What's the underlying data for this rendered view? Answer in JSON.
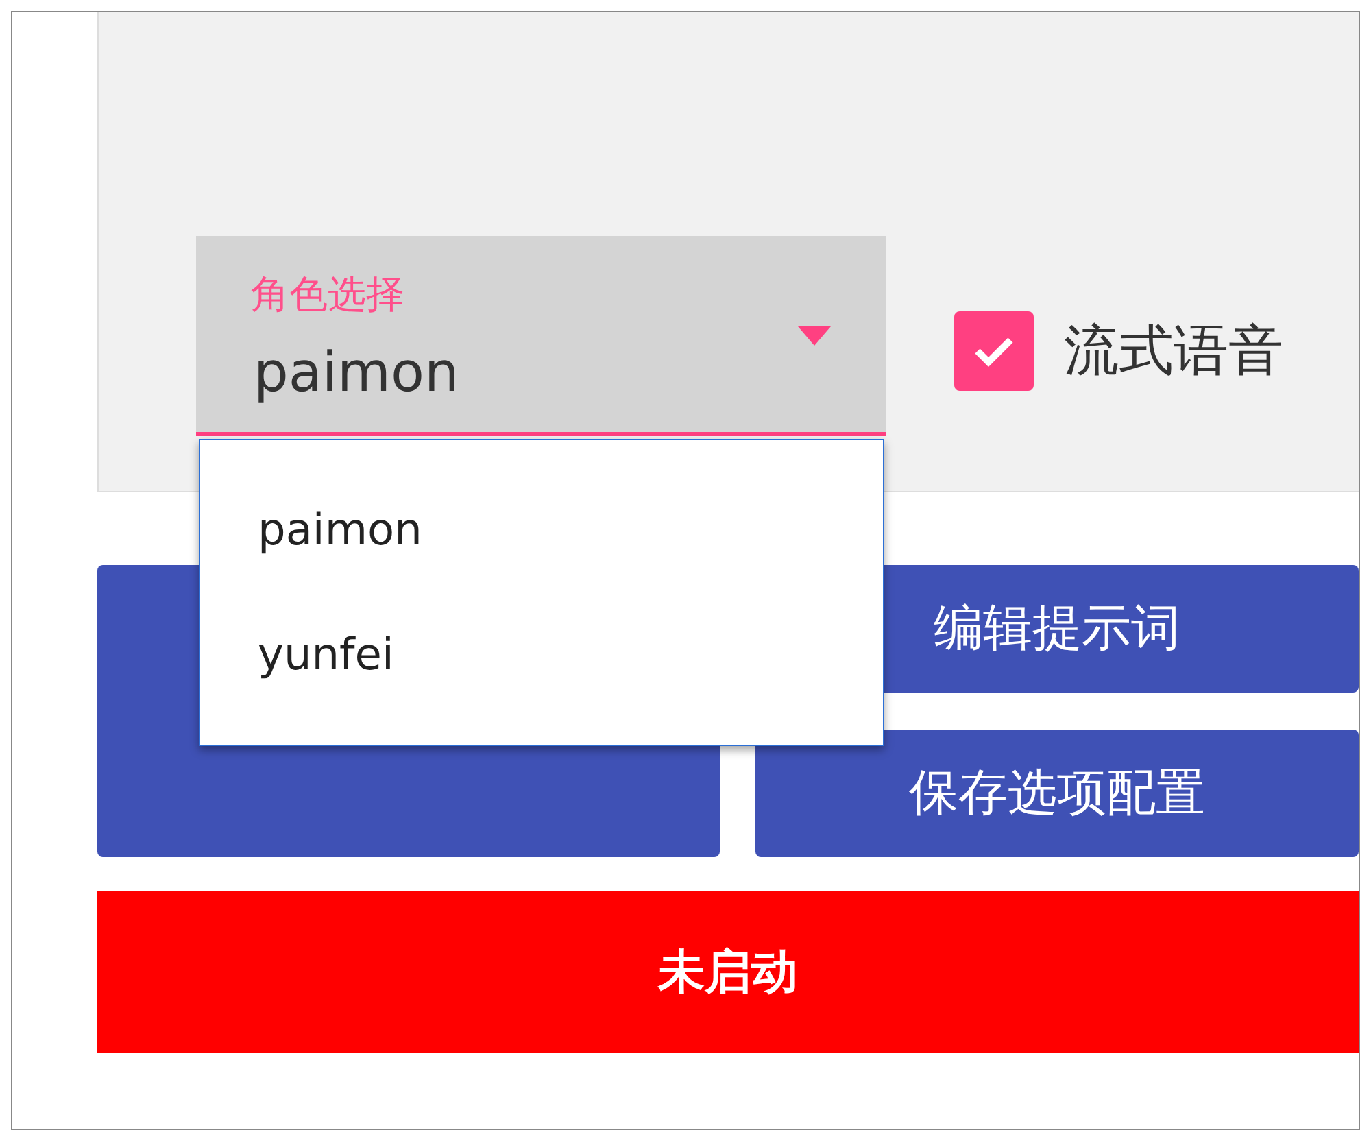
{
  "role_select": {
    "label": "角色选择",
    "value": "paimon",
    "expanded": true,
    "options": [
      {
        "label": "paimon"
      },
      {
        "label": "yunfei"
      }
    ]
  },
  "stream_voice": {
    "label": "流式语音",
    "checked": true
  },
  "buttons": [
    {
      "label": "编辑提示词"
    },
    {
      "label": "保存选项配置"
    }
  ],
  "status_button": {
    "label": "未启动"
  }
}
